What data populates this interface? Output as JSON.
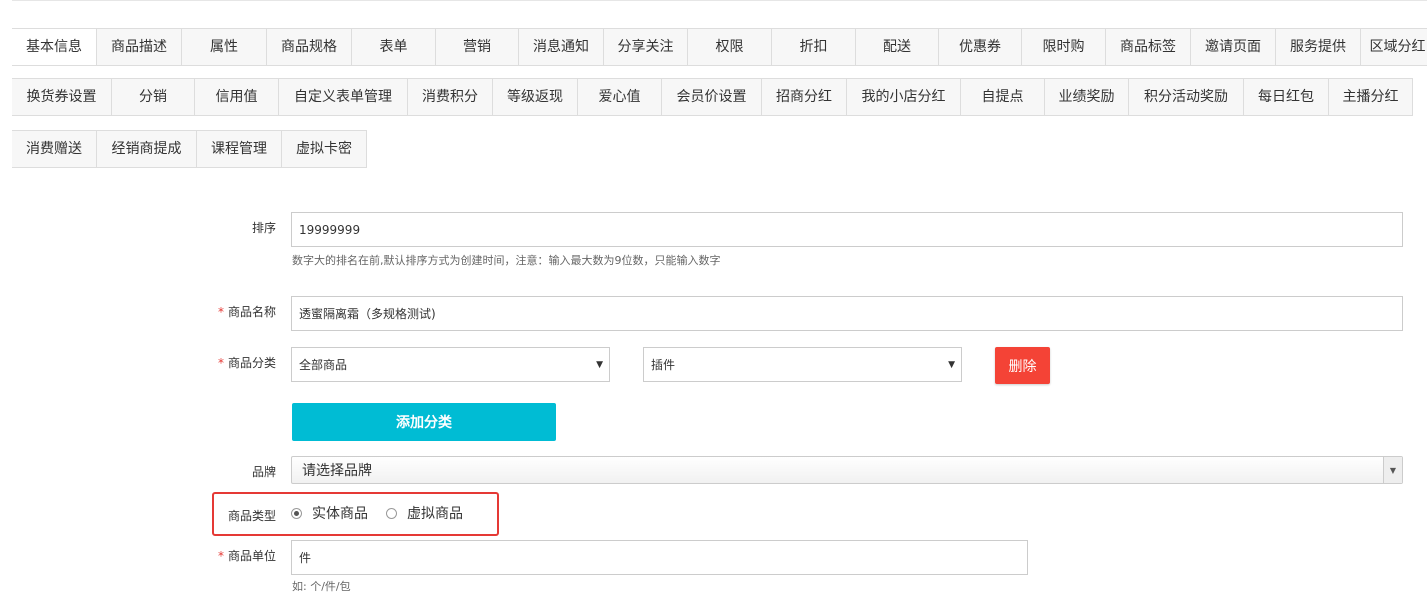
{
  "tabs": {
    "row1": [
      "基本信息",
      "商品描述",
      "属性",
      "商品规格",
      "表单",
      "营销",
      "消息通知",
      "分享关注",
      "权限",
      "折扣",
      "配送",
      "优惠券",
      "限时购",
      "商品标签",
      "邀请页面",
      "服务提供",
      "区域分红"
    ],
    "row2": [
      "换货券设置",
      "分销",
      "信用值",
      "自定义表单管理",
      "消费积分",
      "等级返现",
      "爱心值",
      "会员价设置",
      "招商分红",
      "我的小店分红",
      "自提点",
      "业绩奖励",
      "积分活动奖励",
      "每日红包",
      "主播分红"
    ],
    "row3": [
      "消费赠送",
      "经销商提成",
      "课程管理",
      "虚拟卡密"
    ],
    "active": "基本信息"
  },
  "form": {
    "sort": {
      "label": "排序",
      "value": "19999999",
      "help": "数字大的排名在前,默认排序方式为创建时间，注意：输入最大数为9位数，只能输入数字"
    },
    "name": {
      "required_mark": "*",
      "label": "商品名称",
      "value": "透蜜隔离霜（多规格测试)"
    },
    "category": {
      "required_mark": "*",
      "label": "商品分类",
      "select1": "全部商品",
      "select2": "插件",
      "delete_label": "删除",
      "add_label": "添加分类"
    },
    "brand": {
      "label": "品牌",
      "placeholder": "请选择品牌"
    },
    "type": {
      "label": "商品类型",
      "options": [
        "实体商品",
        "虚拟商品"
      ],
      "selected": "实体商品"
    },
    "unit": {
      "required_mark": "*",
      "label": "商品单位",
      "value": "件",
      "help_partial": "如: 个/件/包"
    }
  },
  "colors": {
    "danger": "#f44336",
    "primary": "#00bcd4",
    "highlight": "#e53935"
  }
}
